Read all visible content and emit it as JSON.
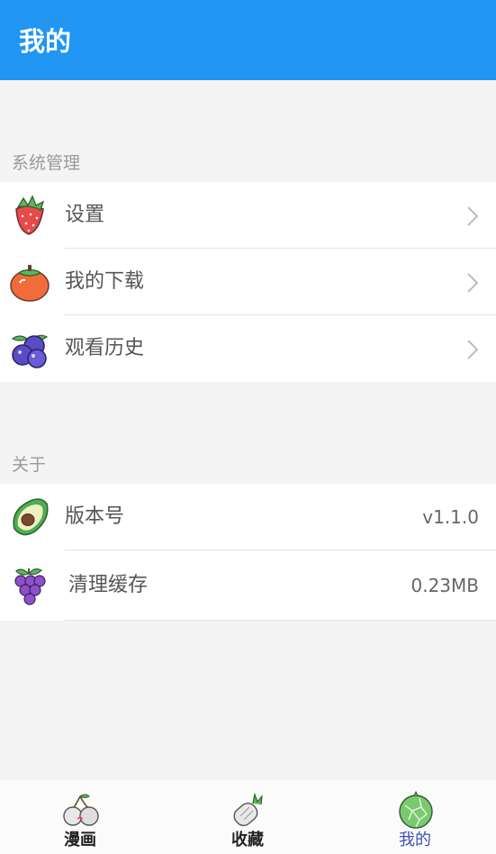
{
  "colors": {
    "app_bar": "#2196f3",
    "active_tab": "#3f51b5"
  },
  "header": {
    "title": "我的"
  },
  "sections": {
    "system": {
      "title": "系统管理",
      "items": [
        {
          "label": "设置",
          "icon": "strawberry-icon"
        },
        {
          "label": "我的下载",
          "icon": "persimmon-icon"
        },
        {
          "label": "观看历史",
          "icon": "blueberry-icon"
        }
      ]
    },
    "about": {
      "title": "关于",
      "items": [
        {
          "label": "版本号",
          "value": "v1.1.0",
          "icon": "avocado-icon"
        },
        {
          "label": "清理缓存",
          "value": "0.23MB",
          "icon": "grape-icon"
        }
      ]
    }
  },
  "bottom_nav": {
    "tabs": [
      {
        "label": "漫画",
        "icon": "cherry-icon"
      },
      {
        "label": "收藏",
        "icon": "pineapple-icon"
      },
      {
        "label": "我的",
        "icon": "melon-icon",
        "active": true
      }
    ]
  }
}
